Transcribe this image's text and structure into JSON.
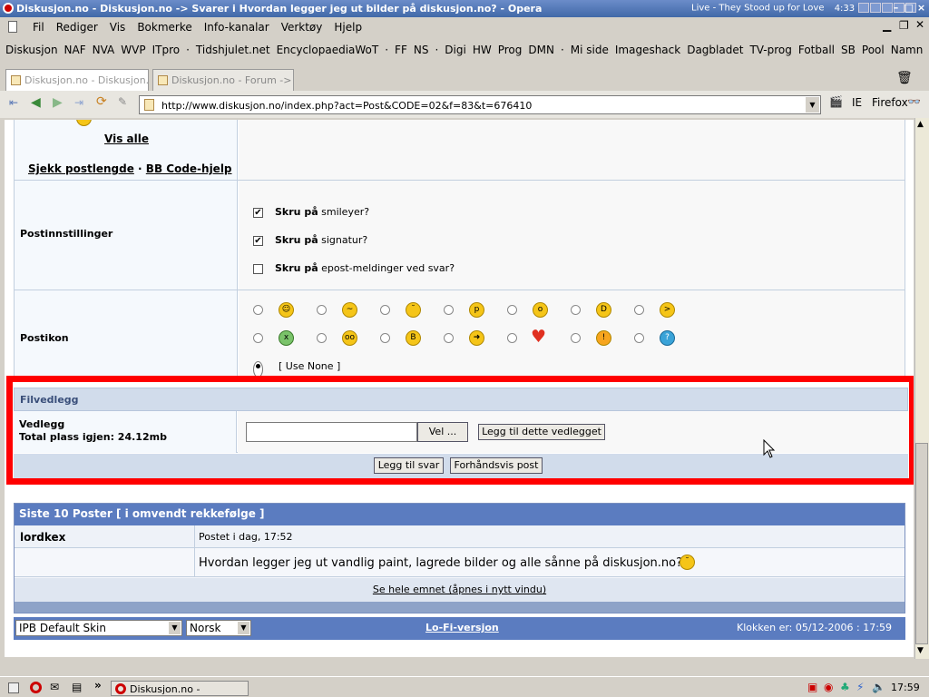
{
  "window": {
    "title": "Diskusjon.no - Diskusjon.no -> Svarer i Hvordan legger jeg ut bilder på diskusjon.no? - Opera",
    "now_playing": "Live - They Stood up for Love",
    "track_time": "4:33"
  },
  "menu": [
    "Fil",
    "Rediger",
    "Vis",
    "Bokmerke",
    "Info-kanalar",
    "Verktøy",
    "Hjelp"
  ],
  "bookmarks": [
    "Diskusjon",
    "NAF",
    "NVA",
    "WVP",
    "ITpro",
    "·",
    "Tidshjulet.net",
    "EncyclopaediaWoT",
    "·",
    "FF",
    "NS",
    "·",
    "Digi",
    "HW",
    "Prog",
    "DMN",
    "·",
    "Mi side",
    "Imageshack",
    "Dagbladet",
    "TV-prog",
    "Fotball",
    "SB",
    "Pool",
    "Namn"
  ],
  "tabs": [
    "Diskusjon.no - Diskusjon...",
    "Diskusjon.no - Forum -> Vi..."
  ],
  "address": {
    "url": "http://www.diskusjon.no/index.php?act=Post&CODE=02&f=83&t=676410"
  },
  "nav_right": {
    "ie": "IE",
    "firefox": "Firefox"
  },
  "editor": {
    "vis_alle": "Vis alle",
    "sjekk": "Sjekk postlengde",
    "sep": "·",
    "bbcode": "BB Code-hjelp"
  },
  "post_options": {
    "label": "Postinnstillinger",
    "options": [
      {
        "bold": "Skru på",
        "text": "smileyer?",
        "checked": true
      },
      {
        "bold": "Skru på",
        "text": "signatur?",
        "checked": true
      },
      {
        "bold": "Skru på",
        "text": "epost-meldinger ved svar?",
        "checked": false
      }
    ]
  },
  "post_icon": {
    "label": "Postikon",
    "use_none": "[ Use None ]"
  },
  "attachments": {
    "header": "Filvedlegg",
    "label": "Vedlegg",
    "quota": "Total plass igjen: 24.12mb",
    "browse": "Vel ...",
    "add": "Legg til dette vedlegget"
  },
  "actions": {
    "submit": "Legg til svar",
    "preview": "Forhåndsvis post"
  },
  "recent": {
    "header": "Siste 10 Poster [ i omvendt rekkefølge ]",
    "author": "lordkex",
    "posted": "Postet i dag, 17:52",
    "body": "Hvordan legger jeg ut vandlig paint, lagrede bilder og alle sånne på diskusjon.no??",
    "see_all": "Se hele emnet (åpnes i nytt vindu)"
  },
  "footer": {
    "skin": "IPB Default Skin",
    "language": "Norsk",
    "lofi": "Lo-Fi-versjon",
    "clock": "Klokken er: 05/12-2006 : 17:59"
  },
  "taskbar": {
    "task": "Diskusjon.no - Diskusj...",
    "time": "17:59"
  },
  "colors": {
    "highlight": "#ff0000",
    "bar": "#5b7cc0",
    "subbar": "#d1dceb"
  }
}
